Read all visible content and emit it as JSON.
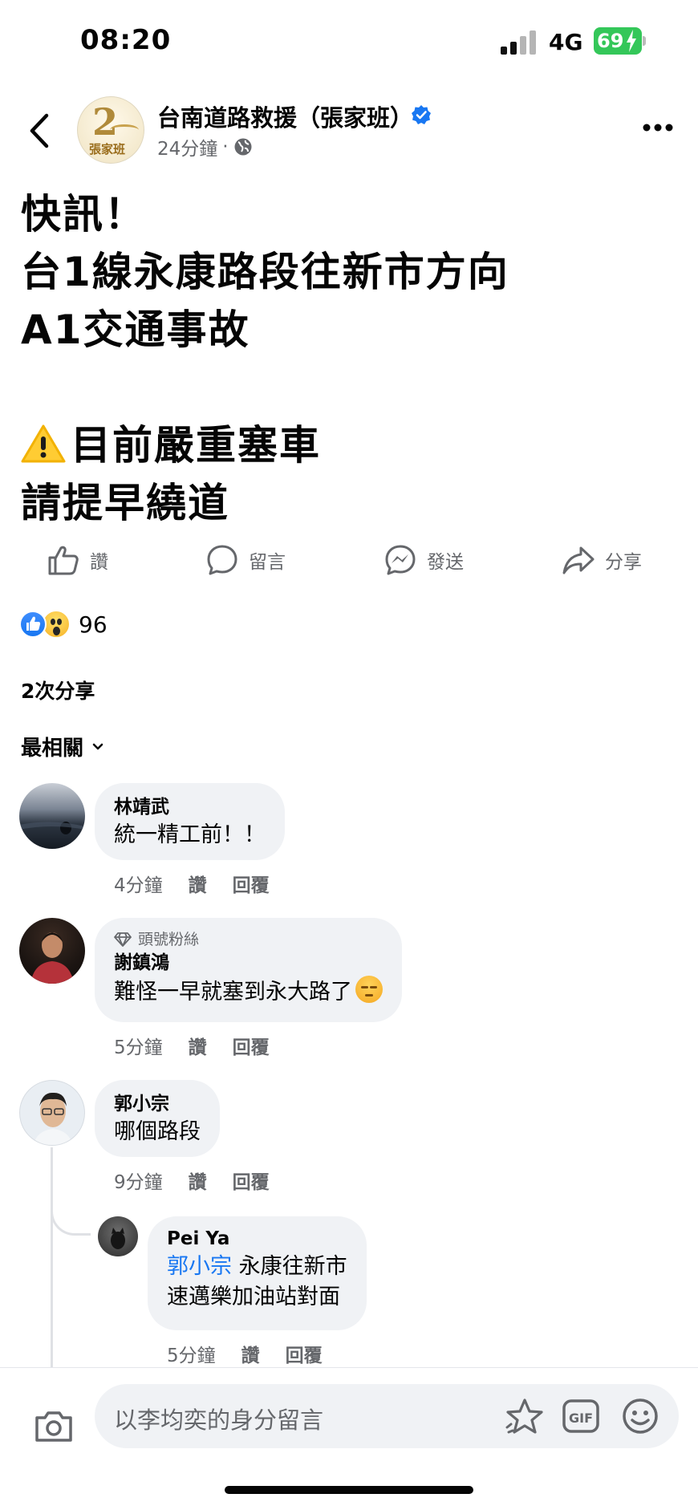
{
  "status_bar": {
    "time": "08:20",
    "network": "4G",
    "battery": "69"
  },
  "header": {
    "page_name": "台南道路救援（張家班）",
    "time_ago": "24分鐘",
    "dot": "·",
    "avatar_digit": "2",
    "avatar_text": "張家班"
  },
  "post": {
    "lines": [
      "快訊！",
      "台1線永康路段往新市方向",
      "A1交通事故"
    ],
    "lines2": [
      "目前嚴重塞車",
      "請提早繞道"
    ]
  },
  "actions": {
    "like": "讚",
    "comment": "留言",
    "send": "發送",
    "share": "分享"
  },
  "reactions": {
    "count": "96"
  },
  "shares": "2次分享",
  "sort_label": "最相關",
  "comments": [
    {
      "name": "林靖武",
      "text": "統一精工前！！",
      "time": "4分鐘",
      "like": "讚",
      "reply": "回覆"
    },
    {
      "badge": "頭號粉絲",
      "name": "謝鎮鴻",
      "text": "難怪一早就塞到永大路了",
      "time": "5分鐘",
      "like": "讚",
      "reply": "回覆"
    },
    {
      "name": "郭小宗",
      "text": "哪個路段",
      "time": "9分鐘",
      "like": "讚",
      "reply": "回覆"
    }
  ],
  "reply": {
    "name": "Pei Ya",
    "mention": "郭小宗",
    "text1": " 永康往新市",
    "text2": "速邁樂加油站對面",
    "time": "5分鐘",
    "like": "讚",
    "reply": "回覆"
  },
  "composer": {
    "placeholder": "以李均奕的身分留言"
  },
  "colors": {
    "accent": "#1877f2",
    "bubble": "#f0f2f5",
    "muted": "#65676b"
  }
}
